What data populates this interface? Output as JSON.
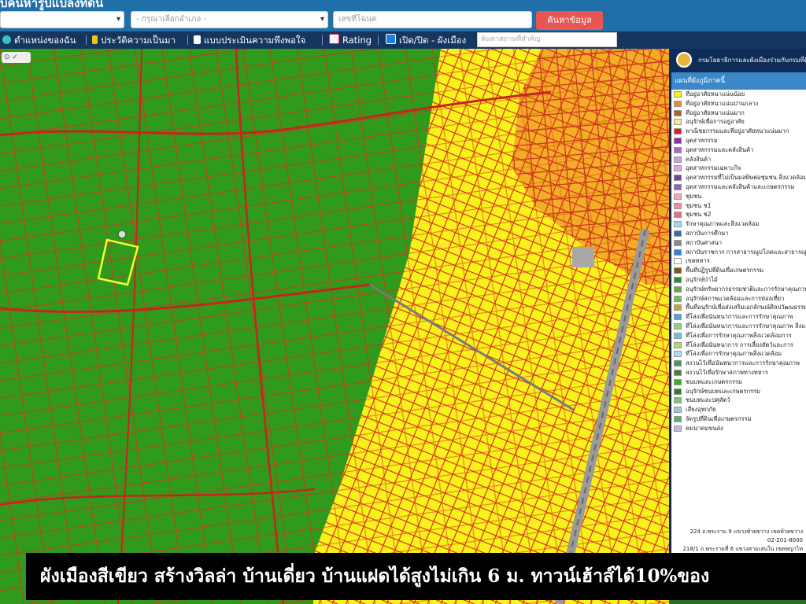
{
  "header": {
    "title": "บค้นหารูปแปลงที่ดิน",
    "select1_value": "",
    "select2_placeholder": "- กรุณาเลือกอำเภอ -",
    "input_placeholder": "เลขที่โฉนด",
    "search_button": "ค้นหาข้อมูล"
  },
  "toolbar": {
    "my_location": "ตำแหน่งของฉัน",
    "history": "ประวัติความเป็นมา",
    "survey": "แบบประเมินความพึงพอใจ",
    "rating": "Rating",
    "toggle_zoning": "เปิด/ปิด - ผังเมือง",
    "place_search_placeholder": "ค้นหาสถานที่สำคัญ"
  },
  "legend": {
    "header": "กรมโยธาธิการและผังเมืองร่วมกับกรมที่ดิน",
    "subtitle": "แผนที่ผังภูมิภาคนี้",
    "items": [
      {
        "label": "ที่อยู่อาศัยหนาแน่นน้อย",
        "color": "#f7f11d"
      },
      {
        "label": "ที่อยู่อาศัยหนาแน่นปานกลาง",
        "color": "#ef8a2b"
      },
      {
        "label": "ที่อยู่อาศัยหนาแน่นมาก",
        "color": "#a8632a"
      },
      {
        "label": "อนุรักษ์เพื่อการอยู่อาศัย",
        "color": "#f5e88a"
      },
      {
        "label": "พาณิชยกรรมและที่อยู่อาศัยหนาแน่นมาก",
        "color": "#e21b1b"
      },
      {
        "label": "อุตสาหกรรม",
        "color": "#8e2ea6"
      },
      {
        "label": "อุตสาหกรรมและคลังสินค้า",
        "color": "#b064c9"
      },
      {
        "label": "คลังสินค้า",
        "color": "#c99be0"
      },
      {
        "label": "อุตสาหกรรมเฉพาะกิจ",
        "color": "#d9a8e6"
      },
      {
        "label": "อุตสาหกรรมที่ไม่เป็นมลพิษต่อชุมชน สิ่งแวดล้อม",
        "color": "#7a3c9e"
      },
      {
        "label": "อุตสาหกรรมและคลังสินค้าและเกษตรกรรม",
        "color": "#9b5fc0"
      },
      {
        "label": "ชุมชน",
        "color": "#f4a6b3"
      },
      {
        "label": "ชุมชน ช1",
        "color": "#f08a9c"
      },
      {
        "label": "ชุมชน ช2",
        "color": "#e86f85"
      },
      {
        "label": "รักษาคุณภาพและสิ่งแวดล้อม",
        "color": "#9ed9f2"
      },
      {
        "label": "สถาบันการศึกษา",
        "color": "#2f6fb0"
      },
      {
        "label": "สถาบันศาสนา",
        "color": "#8b8b8b"
      },
      {
        "label": "สถาบันราชการ การสาธารณูปโภคและสาธารณูปการ",
        "color": "#3a7fd0"
      },
      {
        "label": "เขตทหาร",
        "color": "#ffffff"
      },
      {
        "label": "พื้นที่ปฏิรูปที่ดินเพื่อเกษตรกรรม",
        "color": "#7a5b1e"
      },
      {
        "label": "อนุรักษ์ป่าไม้",
        "color": "#2e8b2e"
      },
      {
        "label": "อนุรักษ์ทรัพยากรธรรมชาติและการรักษาคุณภาพ",
        "color": "#5fae3e"
      },
      {
        "label": "อนุรักษ์สภาพแวดล้อมและการท่องเที่ยว",
        "color": "#6cbf5a"
      },
      {
        "label": "พื้นที่อนุรักษ์เพื่อส่งเสริมเอกลักษณ์ศิลปวัฒนธรรม",
        "color": "#c2a92e"
      },
      {
        "label": "ที่โล่งเพื่อนันทนาการและการรักษาคุณภาพ",
        "color": "#53a6cf"
      },
      {
        "label": "ที่โล่งเพื่อนันทนาการและการรักษาคุณภาพ สิ่งแวดล้อม",
        "color": "#8fd17c"
      },
      {
        "label": "ที่โล่งเพื่อการรักษาคุณภาพสิ่งแวดล้อมการ",
        "color": "#6cc2d6"
      },
      {
        "label": "ที่โล่งเพื่อนันทนาการ การเลี้ยงสัตว์และการ",
        "color": "#b7d96a"
      },
      {
        "label": "ที่โล่งเพื่อการรักษาคุณภาพสิ่งแวดล้อม",
        "color": "#a6dcef"
      },
      {
        "label": "สงวนไว้เพื่อนันทนาการและการรักษาคุณภาพ",
        "color": "#3e9b5a"
      },
      {
        "label": "สงวนไว้เพื่อรักษาสภาพทางทหาร",
        "color": "#4b7a3a"
      },
      {
        "label": "ชนบทและเกษตรกรรม",
        "color": "#3da829"
      },
      {
        "label": "อนุรักษ์ชนบทและเกษตรกรรม",
        "color": "#2f7d24"
      },
      {
        "label": "ชนบทและปศุสัตว์",
        "color": "#88c070"
      },
      {
        "label": "เสี่ยงอุทกภัย",
        "color": "#9fc6d8"
      },
      {
        "label": "จัดรูปที่ดินเพื่อเกษตรกรรม",
        "color": "#56b06b"
      },
      {
        "label": "คมนาคมขนส่ง",
        "color": "#c9b7d6"
      }
    ],
    "footer": [
      "224 ถ.พระราม 9 แขวงห้วยขวาง เขตห้วยขวาง",
      "02-201-8000",
      "218/1 ถ.พระรามที่ 6 แขวงสามเสนใน เขตพญาไท"
    ]
  },
  "caption": "ผังเมืองสีเขียว สร้างวิลล่า บ้านเดี่ยว บ้านแฝดได้สูงไม่เกิน 6 ม.  ทาวน์เฮ้าส์ได้10%ของ",
  "colors": {
    "header_bg": "#1f6fa8",
    "toolbar_bg": "#15365f",
    "rural_green": "#2f9a1c",
    "low_density_yellow": "#f7f11d",
    "medium_density_orange": "#ef8a2b",
    "parcel_line": "#d02a1a",
    "selected_parcel": "#f2ff2a"
  }
}
